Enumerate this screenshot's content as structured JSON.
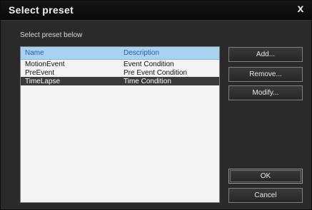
{
  "window": {
    "title": "Select preset",
    "close_glyph": "x"
  },
  "subtitle": "Select preset below",
  "list": {
    "headers": {
      "name": "Name",
      "description": "Description"
    },
    "rows": [
      {
        "name": "MotionEvent",
        "description": "Event Condition",
        "selected": false
      },
      {
        "name": "PreEvent",
        "description": "Pre Event Condition",
        "selected": false
      },
      {
        "name": "TimeLapse",
        "description": "Time Condition",
        "selected": true
      }
    ]
  },
  "buttons": {
    "add": "Add...",
    "remove": "Remove...",
    "modify": "Modify...",
    "ok": "OK",
    "cancel": "Cancel"
  },
  "colors": {
    "header_bg": "#a9d1f0",
    "header_text": "#2a5ea6",
    "selected_row_bg": "#3a3a3a",
    "list_bg": "#f3f3f3"
  }
}
